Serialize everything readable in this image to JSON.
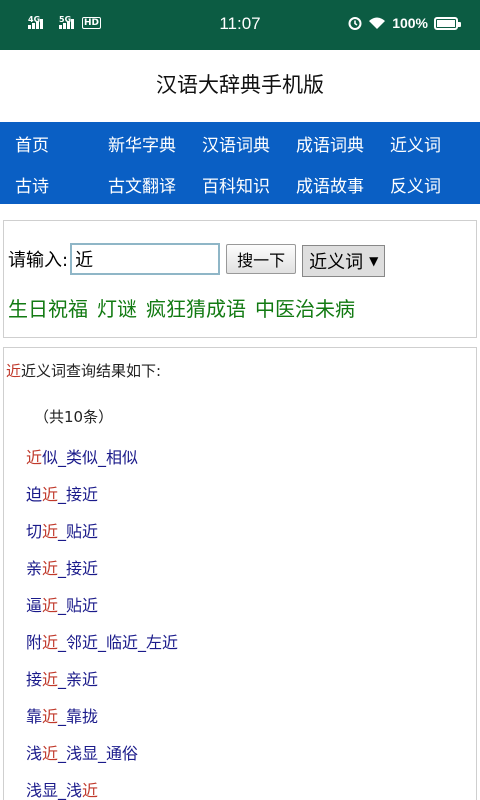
{
  "status_bar": {
    "signal1": "4G",
    "signal2": "5G",
    "hd": "HD",
    "time": "11:07",
    "battery": "100%",
    "icons": [
      "alarm-icon",
      "wifi-icon",
      "battery-icon"
    ]
  },
  "title": "汉语大辞典手机版",
  "nav": {
    "row1": [
      "首页",
      "新华字典",
      "汉语词典",
      "成语词典",
      "近义词"
    ],
    "row2": [
      "古诗",
      "古文翻译",
      "百科知识",
      "成语故事",
      "反义词"
    ]
  },
  "search": {
    "label": "请输入:",
    "value": "近",
    "button": "搜一下",
    "select_value": "近义词",
    "links": [
      "生日祝福",
      "灯谜",
      "疯狂猜成语",
      "中医治未病"
    ]
  },
  "results": {
    "keyword": "近",
    "header_suffix": "近义词查询结果如下:",
    "count": "（共10条）",
    "rows": [
      [
        "近",
        "似_类似_相似"
      ],
      [
        "迫",
        "近",
        "_接近"
      ],
      [
        "切",
        "近",
        "_贴近"
      ],
      [
        "亲",
        "近",
        "_接近"
      ],
      [
        "逼",
        "近",
        "_贴近"
      ],
      [
        "附",
        "近",
        "_邻近_临近_左近"
      ],
      [
        "接",
        "近",
        "_亲近"
      ],
      [
        "靠",
        "近",
        "_靠拢"
      ],
      [
        "浅",
        "近",
        "_浅显_通俗"
      ],
      [
        "浅显_浅",
        "近",
        ""
      ]
    ]
  },
  "colors": {
    "status_bar": "#0c5c43",
    "nav_bg": "#0a5fc4",
    "link_green": "#127a12",
    "highlight_red": "#c0392b",
    "result_blue": "#1a1a8a"
  }
}
